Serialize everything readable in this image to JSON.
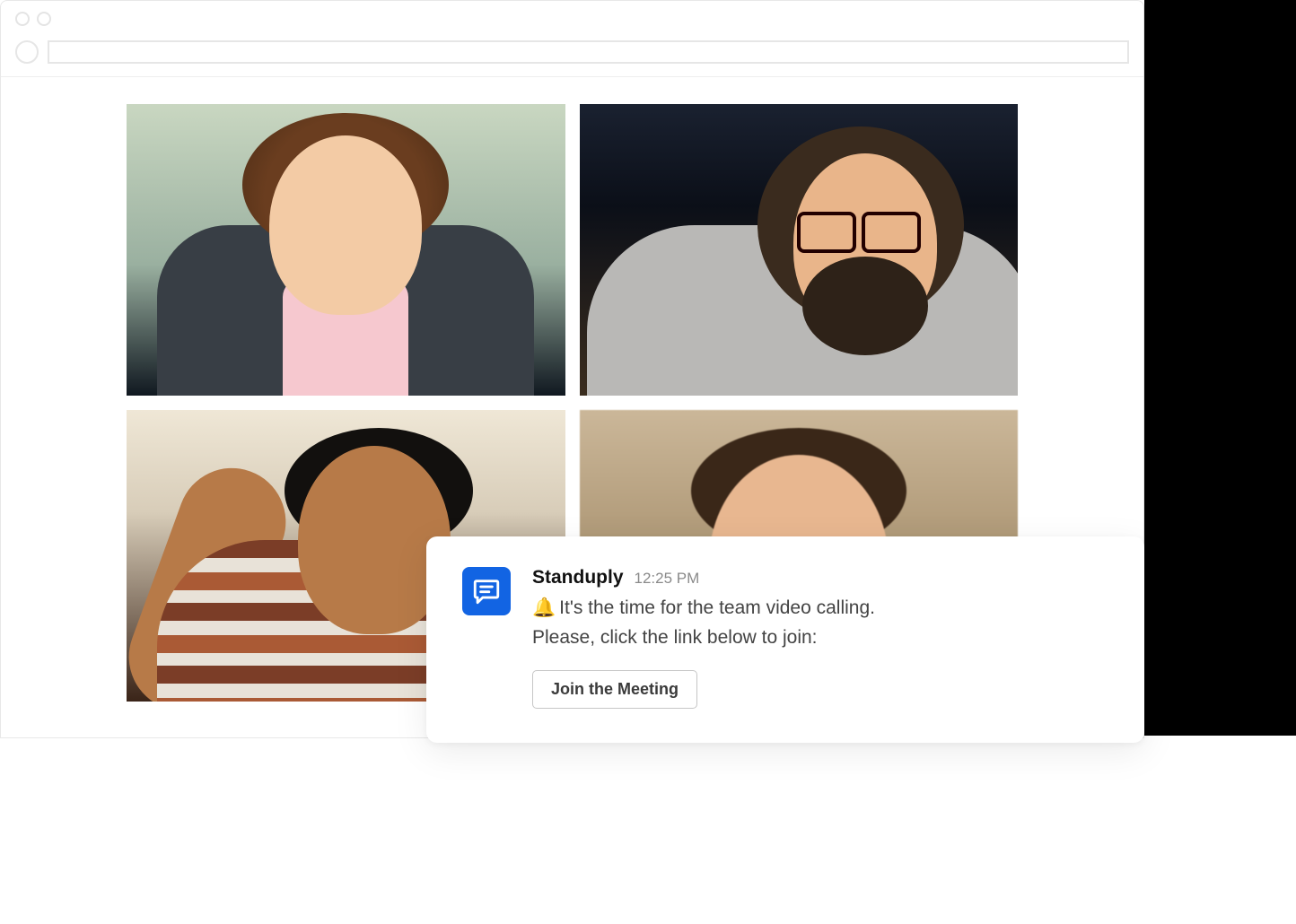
{
  "browser": {
    "url": ""
  },
  "video_grid": {
    "tiles": [
      {
        "participant_slot": "participant-1"
      },
      {
        "participant_slot": "participant-2"
      },
      {
        "participant_slot": "participant-3"
      },
      {
        "participant_slot": "participant-4"
      }
    ]
  },
  "notification": {
    "sender": "Standuply",
    "timestamp": "12:25 PM",
    "bell_icon": "🔔",
    "message_line1": "It's the time for the team video calling.",
    "message_line2": "Please, click the link below to join:",
    "join_button_label": "Join the Meeting",
    "app_icon_name": "chat-bubble-icon",
    "app_icon_color": "#1264e3"
  }
}
